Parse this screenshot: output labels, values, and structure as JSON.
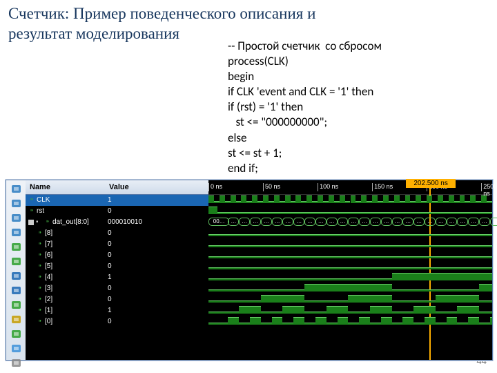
{
  "title": "Счетчик: Пример поведенческого описания и результат моделирования",
  "code": "-- Простой счетчик  со сбросом\nprocess(CLK)\nbegin\nif CLK 'event and CLK = '1' then\nif (rst) = '1' then\n   st <= \"000000000\";\nelse\nst <= st + 1;\nend if;",
  "page_num": "44",
  "sim": {
    "name_header": "Name",
    "value_header": "Value",
    "cursor_label": "202.500 ns",
    "cursor_ns": 202.5,
    "time_end_ns": 260,
    "ticks_ns": [
      0,
      50,
      100,
      150,
      200,
      250
    ],
    "tick_labels": [
      "0 ns",
      "50 ns",
      "100 ns",
      "150 ns",
      "200 ns",
      "250 ns"
    ],
    "clk_period_ns": 10,
    "signals": [
      {
        "name": "CLK",
        "value": "1",
        "type": "clock",
        "selected": true
      },
      {
        "name": "rst",
        "value": "0",
        "type": "rst"
      },
      {
        "name": "dat_out[8:0]",
        "value": "000010010",
        "type": "bus"
      },
      {
        "name": "[8]",
        "value": "0",
        "type": "bit",
        "bit": 8,
        "indent": true
      },
      {
        "name": "[7]",
        "value": "0",
        "type": "bit",
        "bit": 7,
        "indent": true
      },
      {
        "name": "[6]",
        "value": "0",
        "type": "bit",
        "bit": 6,
        "indent": true
      },
      {
        "name": "[5]",
        "value": "0",
        "type": "bit",
        "bit": 5,
        "indent": true
      },
      {
        "name": "[4]",
        "value": "1",
        "type": "bit",
        "bit": 4,
        "indent": true
      },
      {
        "name": "[3]",
        "value": "0",
        "type": "bit",
        "bit": 3,
        "indent": true
      },
      {
        "name": "[2]",
        "value": "0",
        "type": "bit",
        "bit": 2,
        "indent": true
      },
      {
        "name": "[1]",
        "value": "1",
        "type": "bit",
        "bit": 1,
        "indent": true
      },
      {
        "name": "[0]",
        "value": "0",
        "type": "bit",
        "bit": 0,
        "indent": true
      }
    ],
    "toolbar_icons": [
      "zoom-in",
      "zoom-out",
      "zoom-fit",
      "zoom-sel",
      "prev-edge",
      "next-edge",
      "first",
      "last",
      "play",
      "add-marker",
      "swap",
      "measure",
      "ruler"
    ]
  }
}
